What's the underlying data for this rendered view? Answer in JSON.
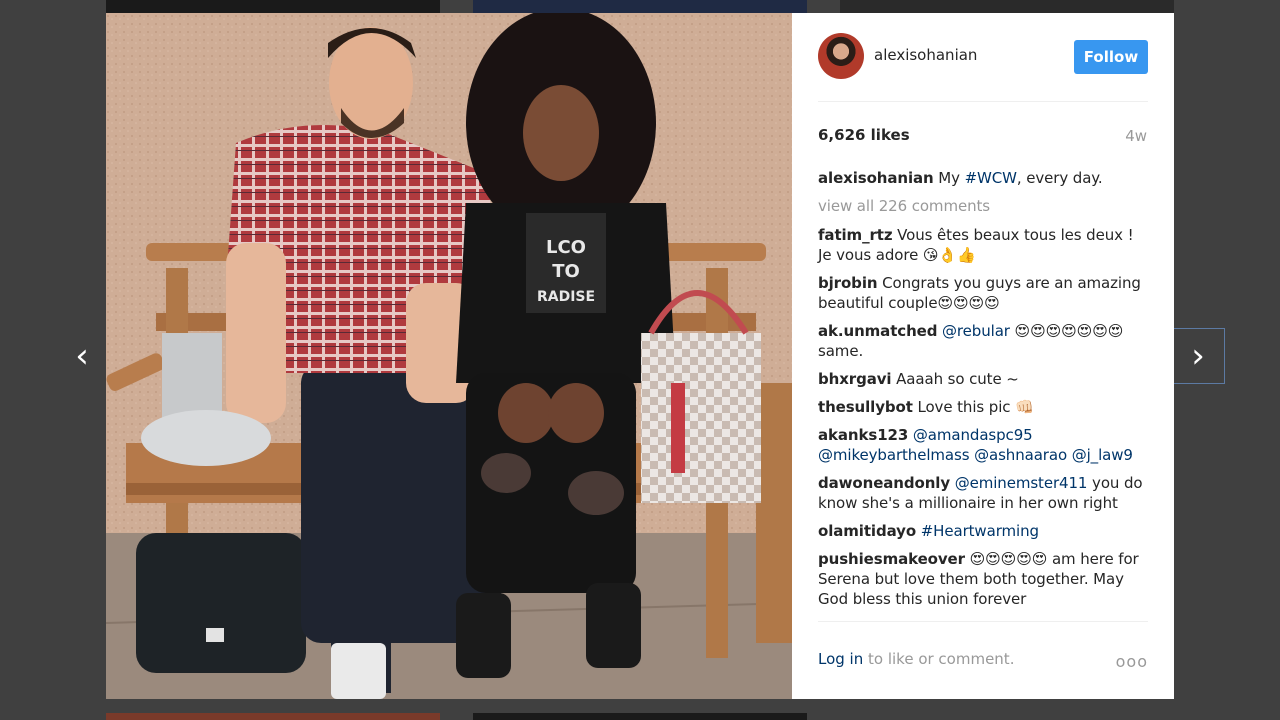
{
  "post": {
    "username": "alexisohanian",
    "follow_label": "Follow",
    "likes": "6,626 likes",
    "age": "4w",
    "caption": {
      "user": "alexisohanian",
      "pre": "My ",
      "tag": "#WCW",
      "post": ", every day."
    },
    "view_all": "view all 226 comments"
  },
  "comments": [
    {
      "user": "fatim_rtz",
      "text": "Vous êtes beaux tous les deux ! Je vous adore 😘👌👍"
    },
    {
      "user": "bjrobin",
      "text": "Congrats you guys are an amazing beautiful couple😍😍😍😍"
    },
    {
      "user": "ak.unmatched",
      "mention": "@rebular",
      "text": " 😍😍😍😍😍😍😍 same."
    },
    {
      "user": "bhxrgavi",
      "text": "Aaaah so cute ~"
    },
    {
      "user": "thesullybot",
      "text": "Love this pic 👊🏻"
    },
    {
      "user": "akanks123",
      "mention": "@amandaspc95 @mikeybarthelmass @ashnaarao @j_law9",
      "text": ""
    },
    {
      "user": "dawoneandonly",
      "mention": "@eminemster411",
      "text": " you do know she's a millionaire in her own right"
    },
    {
      "user": "olamitidayo",
      "mention": "#Heartwarming",
      "text": ""
    },
    {
      "user": "pushiesmakeover",
      "text": "😍😍😍😍😍 am here for Serena but love them both together. May God bless this union forever"
    }
  ],
  "footer": {
    "login": "Log in",
    "rest": " to like or comment.",
    "more": "ooo"
  },
  "nav": {
    "prev": "‹",
    "next": "›"
  },
  "colors": {
    "accent": "#3897f0",
    "link": "#003569",
    "muted": "#999999",
    "backdrop": "#404040"
  }
}
